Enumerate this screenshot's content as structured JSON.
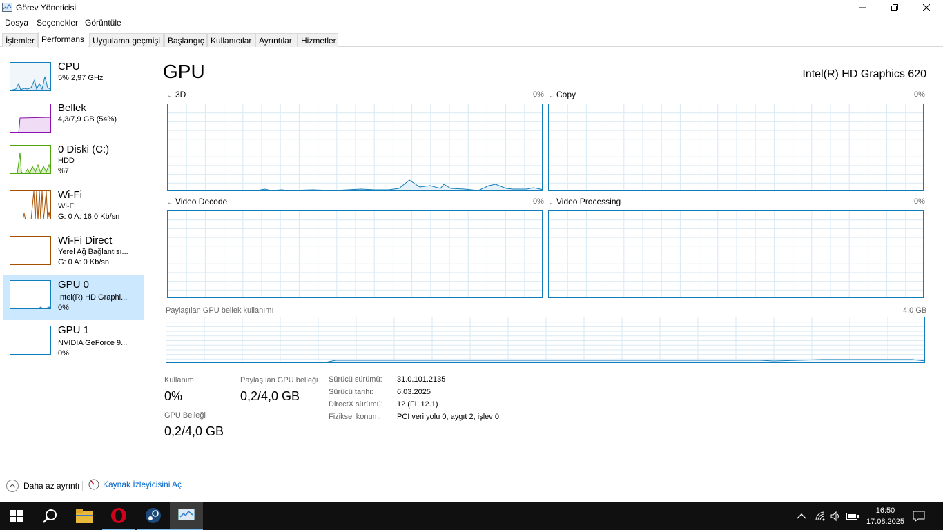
{
  "window": {
    "title": "Görev Yöneticisi"
  },
  "menu": [
    "Dosya",
    "Seçenekler",
    "Görüntüle"
  ],
  "tabs": [
    "İşlemler",
    "Performans",
    "Uygulama geçmişi",
    "Başlangıç",
    "Kullanıcılar",
    "Ayrıntılar",
    "Hizmetler"
  ],
  "active_tab": "Performans",
  "sidebar": [
    {
      "name": "CPU",
      "line1": "5% 2,97 GHz",
      "line2": "",
      "color": "#117dbb"
    },
    {
      "name": "Bellek",
      "line1": "4,3/7,9 GB (54%)",
      "line2": "",
      "color": "#8b12ae"
    },
    {
      "name": "0 Diski (C:)",
      "line1": "HDD",
      "line2": "%7",
      "color": "#4da60c"
    },
    {
      "name": "Wi-Fi",
      "line1": "Wi-Fi",
      "line2": "G: 0 A: 16,0 Kb/sn",
      "color": "#a74f01"
    },
    {
      "name": "Wi-Fi Direct",
      "line1": "Yerel Ağ Bağlantısı...",
      "line2": "G: 0 A: 0 Kb/sn",
      "color": "#a74f01"
    },
    {
      "name": "GPU 0",
      "line1": "Intel(R) HD Graphi...",
      "line2": "0%",
      "color": "#117dbb"
    },
    {
      "name": "GPU 1",
      "line1": "NVIDIA GeForce 9...",
      "line2": "0%",
      "color": "#117dbb"
    }
  ],
  "main": {
    "title": "GPU",
    "device": "Intel(R) HD Graphics 620",
    "engines": [
      {
        "label": "3D",
        "pct": "0%"
      },
      {
        "label": "Copy",
        "pct": "0%"
      },
      {
        "label": "Video Decode",
        "pct": "0%"
      },
      {
        "label": "Video Processing",
        "pct": "0%"
      }
    ],
    "shared_mem": {
      "label": "Paylaşılan GPU bellek kullanımı",
      "max": "4,0 GB"
    },
    "stats": {
      "usage_label": "Kullanım",
      "usage_value": "0%",
      "shared_label": "Paylaşılan GPU belleği",
      "shared_value": "0,2/4,0 GB",
      "gpumem_label": "GPU Belleği",
      "gpumem_value": "0,2/4,0 GB"
    },
    "info": [
      {
        "k": "Sürücü sürümü:",
        "v": "31.0.101.2135"
      },
      {
        "k": "Sürücü tarihi:",
        "v": "6.03.2025"
      },
      {
        "k": "DirectX sürümü:",
        "v": "12 (FL 12.1)"
      },
      {
        "k": "Fiziksel konum:",
        "v": "PCI veri yolu 0, aygıt 2, işlev 0"
      }
    ]
  },
  "footer": {
    "less_details": "Daha az ayrıntı",
    "resmon": "Kaynak İzleyicisini Aç"
  },
  "taskbar": {
    "time": "16:50",
    "date": "17.08.2025"
  }
}
